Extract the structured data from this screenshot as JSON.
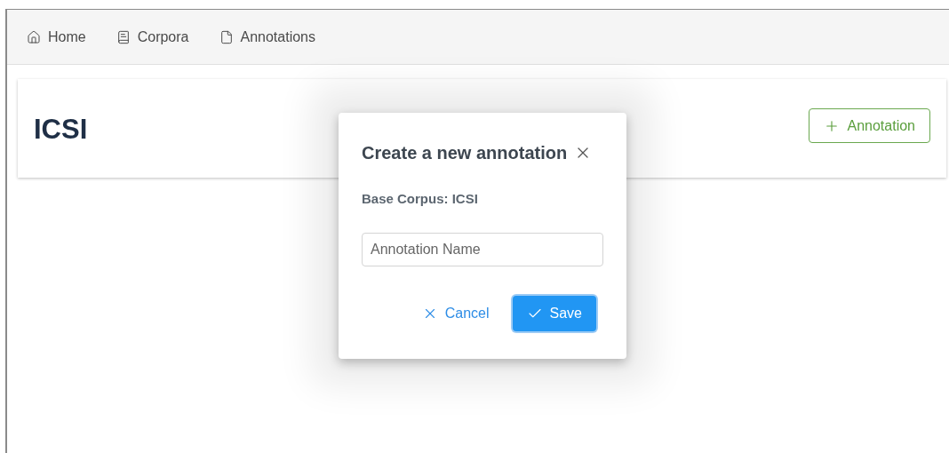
{
  "nav": {
    "items": [
      {
        "label": "Home",
        "kind": "home"
      },
      {
        "label": "Corpora",
        "kind": "corpora"
      },
      {
        "label": "Annotations",
        "kind": "annotations"
      }
    ]
  },
  "header": {
    "title": "ICSI",
    "add_button": "Annotation"
  },
  "dialog": {
    "title": "Create a new annotation",
    "subtitle": "Base Corpus: ICSI",
    "name_field": {
      "placeholder": "Annotation Name"
    },
    "cancel_button": "Cancel",
    "save_button": "Save"
  }
}
